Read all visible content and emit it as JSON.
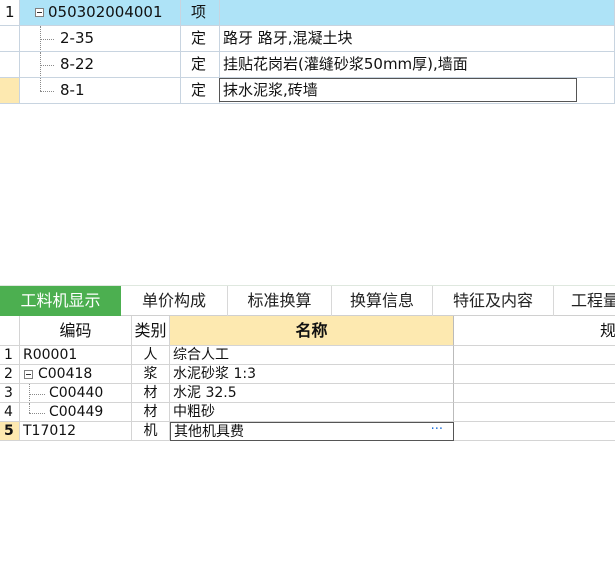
{
  "upper_table": {
    "rows": [
      {
        "index": "1",
        "code": "050302004001",
        "type": "项",
        "name": ""
      },
      {
        "index": "",
        "code": "2-35",
        "type": "定",
        "name": "路牙 路牙,混凝土块"
      },
      {
        "index": "",
        "code": "8-22",
        "type": "定",
        "name": "挂贴花岗岩(灌缝砂浆50mm厚),墙面"
      },
      {
        "index": "",
        "code": "8-1",
        "type": "定",
        "name": "抹水泥浆,砖墙"
      }
    ]
  },
  "tabs": [
    {
      "label": "工料机显示",
      "active": true
    },
    {
      "label": "单价构成"
    },
    {
      "label": "标准换算"
    },
    {
      "label": "换算信息"
    },
    {
      "label": "特征及内容"
    },
    {
      "label": "工程量"
    }
  ],
  "lower_table": {
    "headers": {
      "code": "编码",
      "type": "类别",
      "name": "名称",
      "spec": "规"
    },
    "rows": [
      {
        "index": "1",
        "code": "R00001",
        "type": "人",
        "name": "综合人工"
      },
      {
        "index": "2",
        "code": "C00418",
        "type": "浆",
        "name": "水泥砂浆 1:3"
      },
      {
        "index": "3",
        "code": "C00440",
        "type": "材",
        "name": "水泥 32.5"
      },
      {
        "index": "4",
        "code": "C00449",
        "type": "材",
        "name": "中粗砂"
      },
      {
        "index": "5",
        "code": "T17012",
        "type": "机",
        "name": "其他机具费"
      }
    ],
    "ellipsis": "···"
  },
  "colors": {
    "selected_row": "#aee3f7",
    "active_tab": "#4caf50",
    "header_highlight": "#fde9b0"
  }
}
